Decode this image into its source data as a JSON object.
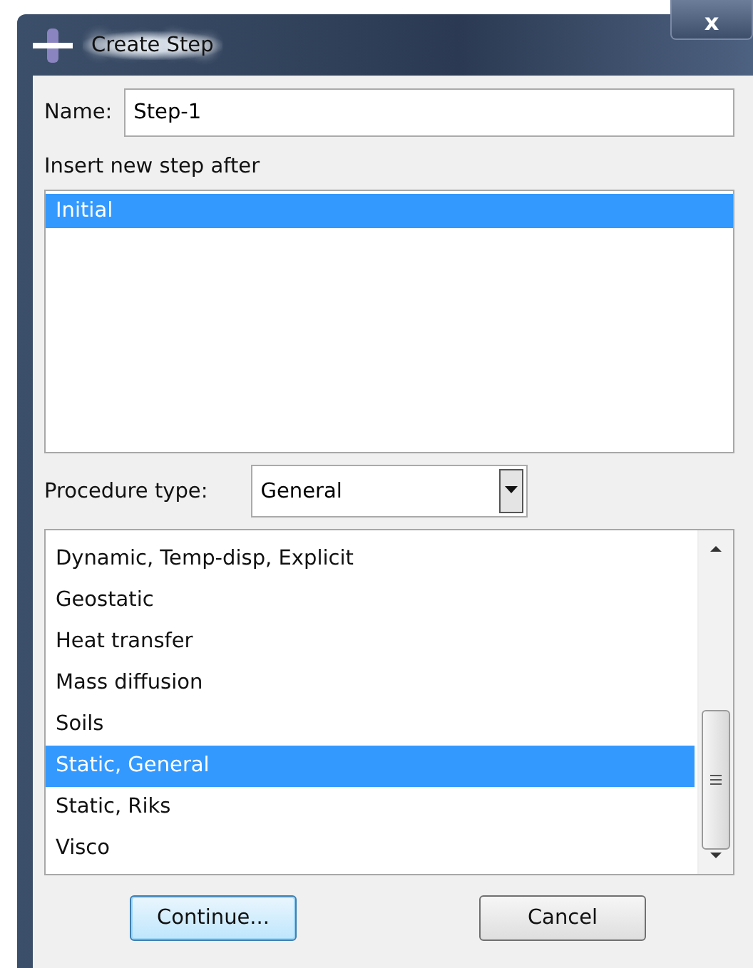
{
  "window": {
    "title": "Create Step",
    "close": "x"
  },
  "name_field": {
    "label": "Name:",
    "value": "Step-1"
  },
  "insert_after": {
    "label": "Insert new step after",
    "items": [
      {
        "label": "Initial",
        "selected": true
      }
    ]
  },
  "procedure_type": {
    "label": "Procedure type:",
    "value": "General"
  },
  "procedures": {
    "items": [
      {
        "label": "Dynamic, Temp-disp, Explicit",
        "selected": false
      },
      {
        "label": "Geostatic",
        "selected": false
      },
      {
        "label": "Heat transfer",
        "selected": false
      },
      {
        "label": "Mass diffusion",
        "selected": false
      },
      {
        "label": "Soils",
        "selected": false
      },
      {
        "label": "Static, General",
        "selected": true
      },
      {
        "label": "Static, Riks",
        "selected": false
      },
      {
        "label": "Visco",
        "selected": false
      }
    ]
  },
  "buttons": [
    {
      "label": "Continue...",
      "default": true
    },
    {
      "label": "Cancel",
      "default": false
    }
  ]
}
